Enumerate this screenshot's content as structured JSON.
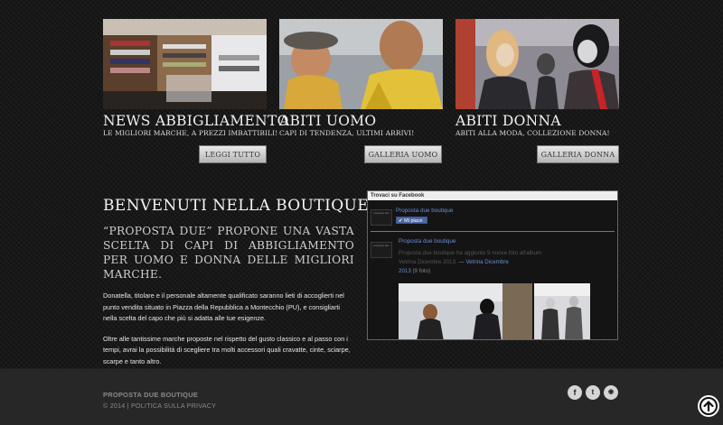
{
  "columns": [
    {
      "title": "NEWS ABBIGLIAMENTO",
      "subtitle": "LE MIGLIORI MARCHE, A PREZZI IMBATTIBILI!",
      "button": "LEGGI TUTTO"
    },
    {
      "title": "ABITI UOMO",
      "subtitle": "CAPI DI TENDENZA, ULTIMI ARRIVI!",
      "button": "GALLERIA UOMO"
    },
    {
      "title": "ABITI DONNA",
      "subtitle": "ABITI ALLA MODA, COLLEZIONE DONNA!",
      "button": "GALLERIA DONNA"
    }
  ],
  "welcome": {
    "heading": "BENVENUTI NELLA BOUTIQUE…",
    "lead": "“PROPOSTA DUE” PROPONE UNA VASTA SCELTA DI CAPI DI ABBIGLIAMENTO PER UOMO E DONNA DELLE MIGLIORI MARCHE.",
    "para1": "Donatella, titolare e il personale altamente qualificato saranno lieti di accoglierti nel punto vendita situato in Piazza della Repubblica a Montecchio (PU), e consigliarti nella scelta del capo che più si adatta alle tue esigenze.",
    "para2": "Oltre alle tantissime marche proposte nel rispetto del gusto classico e al passo con i tempi, avrai la possibilità di scegliere tra molti accessori quali cravatte, cinte, sciarpe, scarpe e tanto altro."
  },
  "facebook": {
    "header": "Trovaci su Facebook",
    "page_name": "Proposta due boutique",
    "like": "Mi piace",
    "thumb_text": "proposta due",
    "post_author": "Proposta due boutique",
    "post_line1": "Proposta due boutique ha aggiunto 9 nuove foto all'album",
    "post_line2": "Vetrina Dicembre 2013.",
    "post_album_a": "— Vetrina Dicembre",
    "post_album_b": "2013",
    "post_count": "(9 foto)"
  },
  "footer": {
    "brand": "PROPOSTA DUE BOUTIQUE",
    "copyright": "© 2014 | POLITICA SULLA PRIVACY",
    "social": [
      {
        "icon": "facebook-icon",
        "glyph": "f"
      },
      {
        "icon": "twitter-icon",
        "glyph": "t"
      },
      {
        "icon": "rss-icon",
        "glyph": "◉"
      }
    ]
  }
}
